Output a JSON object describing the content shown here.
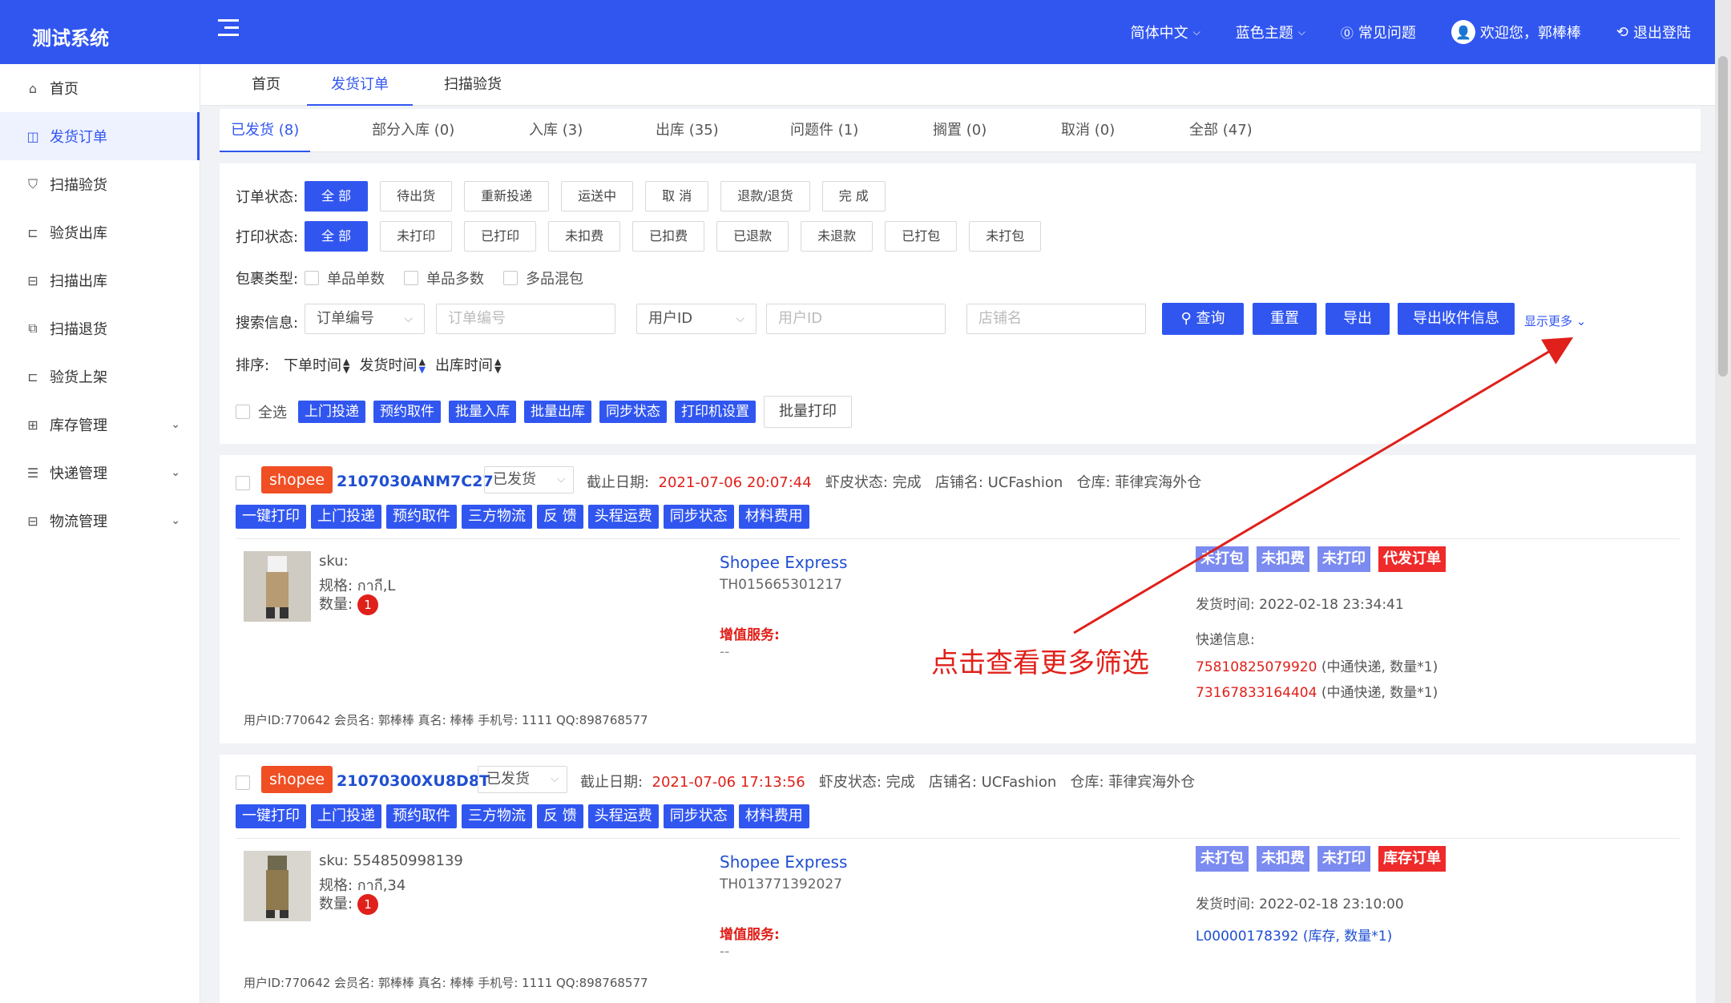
{
  "header": {
    "app_title": "测试系统",
    "language": "简体中文",
    "theme": "蓝色主题",
    "faq": "常见问题",
    "welcome": "欢迎您，郭棒棒",
    "logout": "退出登陆"
  },
  "sidebar": {
    "items": [
      {
        "label": "首页",
        "icon": "home-icon"
      },
      {
        "label": "发货订单",
        "icon": "bag-icon",
        "active": true
      },
      {
        "label": "扫描验货",
        "icon": "shield-icon"
      },
      {
        "label": "验货出库",
        "icon": "scan-icon"
      },
      {
        "label": "扫描出库",
        "icon": "box-icon"
      },
      {
        "label": "扫描退货",
        "icon": "return-icon"
      },
      {
        "label": "验货上架",
        "icon": "scan-icon"
      },
      {
        "label": "库存管理",
        "icon": "grid-icon"
      },
      {
        "label": "快递管理",
        "icon": "list-icon"
      },
      {
        "label": "物流管理",
        "icon": "truck-icon"
      }
    ]
  },
  "top_tabs": [
    "首页",
    "发货订单",
    "扫描验货"
  ],
  "status_tabs": [
    "已发货 (8)",
    "部分入库 (0)",
    "入库 (3)",
    "出库 (35)",
    "问题件 (1)",
    "搁置 (0)",
    "取消 (0)",
    "全部 (47)"
  ],
  "filter": {
    "order_status_label": "订单状态:",
    "order_status": [
      "全 部",
      "待出货",
      "重新投递",
      "运送中",
      "取 消",
      "退款/退货",
      "完 成"
    ],
    "print_status_label": "打印状态:",
    "print_status": [
      "全 部",
      "未打印",
      "已打印",
      "未扣费",
      "已扣费",
      "已退款",
      "未退款",
      "已打包",
      "未打包"
    ],
    "package_type_label": "包裹类型:",
    "package_types": [
      "单品单数",
      "单品多数",
      "多品混包"
    ],
    "search_label": "搜索信息:",
    "search_select1": "订单编号",
    "search_input1_placeholder": "订单编号",
    "search_select2": "用户ID",
    "search_input2_placeholder": "用户ID",
    "search_input3_placeholder": "店铺名",
    "btn_query": "查询",
    "btn_reset": "重置",
    "btn_export": "导出",
    "btn_export_receiver": "导出收件信息",
    "show_more": "显示更多",
    "sort_label": "排序:",
    "sort_items": [
      "下单时间",
      "发货时间",
      "出库时间"
    ],
    "select_all": "全选",
    "batch_actions": [
      "上门投递",
      "预约取件",
      "批量入库",
      "批量出库",
      "同步状态",
      "打印机设置"
    ],
    "batch_print": "批量打印"
  },
  "action_labels": [
    "一键打印",
    "上门投递",
    "预约取件",
    "三方物流",
    "反 馈",
    "头程运费",
    "同步状态",
    "材料费用"
  ],
  "orders": [
    {
      "platform": "shopee",
      "order_no": "2107030ANM7C27",
      "status": "已发货",
      "deadline_label": "截止日期:",
      "deadline": "2021-07-06 20:07:44",
      "shopee_status": "虾皮状态: 完成",
      "shop": "店铺名: UCFashion",
      "warehouse": "仓库: 菲律宾海外仓",
      "sku": "sku:",
      "spec": "规格: กากี,L",
      "qty_label": "数量:",
      "qty": "1",
      "carrier": "Shopee Express",
      "tracking": "TH015665301217",
      "vas_label": "增值服务:",
      "vas_value": "--",
      "tags": [
        "未打包",
        "未扣费",
        "未打印",
        "代发订单"
      ],
      "ship_time": "发货时间: 2022-02-18 23:34:41",
      "express_label": "快递信息:",
      "express": [
        {
          "no": "75810825079920",
          "desc": "(中通快递, 数量*1)"
        },
        {
          "no": "73167833164404",
          "desc": "(中通快递, 数量*1)"
        }
      ],
      "footer": "用户ID:770642   会员名: 郭棒棒    真名: 棒棒  手机号: 1111    QQ:898768577"
    },
    {
      "platform": "shopee",
      "order_no": "21070300XU8D8T",
      "status": "已发货",
      "deadline_label": "截止日期:",
      "deadline": "2021-07-06 17:13:56",
      "shopee_status": "虾皮状态: 完成",
      "shop": "店铺名: UCFashion",
      "warehouse": "仓库: 菲律宾海外仓",
      "sku": "sku: 554850998139",
      "spec": "规格: กากี,34",
      "qty_label": "数量:",
      "qty": "1",
      "carrier": "Shopee Express",
      "tracking": "TH013771392027",
      "vas_label": "增值服务:",
      "vas_value": "--",
      "tags": [
        "未打包",
        "未扣费",
        "未打印",
        "库存订单"
      ],
      "ship_time": "发货时间: 2022-02-18 23:10:00",
      "express_label": "",
      "express": [
        {
          "no": "L00000178392",
          "desc": "(库存, 数量*1)"
        }
      ],
      "footer": "用户ID:770642   会员名: 郭棒棒    真名: 棒棒  手机号: 1111    QQ:898768577"
    }
  ],
  "annotation": "点击查看更多筛选",
  "colors": {
    "primary": "#3156f0",
    "danger": "#e0201a",
    "tag_purple": "#7b8bf0",
    "platform": "#f04e23"
  }
}
